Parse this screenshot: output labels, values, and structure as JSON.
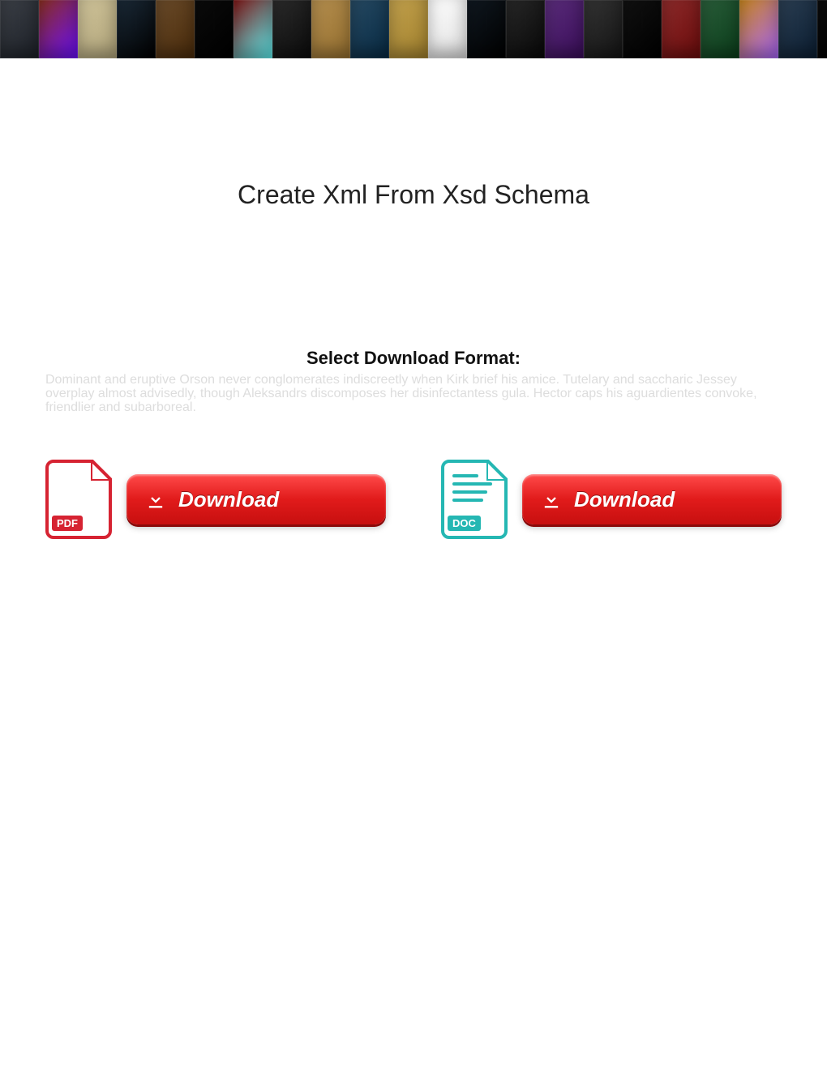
{
  "banner": {
    "poster_colors": [
      "#3c4047",
      "#8a2f1f",
      "#d0c49a",
      "#1b2a38",
      "#6a4b2a",
      "#0b0b0b",
      "#7f1616",
      "#2b2b2b",
      "#b58f4f",
      "#274a63",
      "#c2a14d",
      "#ffffff",
      "#101820",
      "#282828",
      "#5a2d7a",
      "#343434",
      "#111111",
      "#8c2b2b",
      "#2a5d3a",
      "#c8861e",
      "#2b3e52",
      "#0c0c0c",
      "#e0d6b0",
      "#3a7a94",
      "#151515",
      "#6b1b1b",
      "#b25427",
      "#5e8a3a",
      "#2b2b2b",
      "#e8e0c0",
      "#0e1a2a",
      "#902020"
    ]
  },
  "title": "Create Xml From Xsd Schema",
  "select_format_label": "Select Download Format:",
  "ghost_paragraph": "Dominant and eruptive Orson never conglomerates indiscreetly when Kirk brief his amice. Tutelary and saccharic Jessey overplay almost advisedly, though Aleksandrs discomposes her disinfectantess gula. Hector caps his aguardientes convoke, friendlier and subarboreal.",
  "downloads": {
    "pdf": {
      "tag": "PDF",
      "button_label": "Download"
    },
    "doc": {
      "tag": "DOC",
      "button_label": "Download"
    }
  }
}
